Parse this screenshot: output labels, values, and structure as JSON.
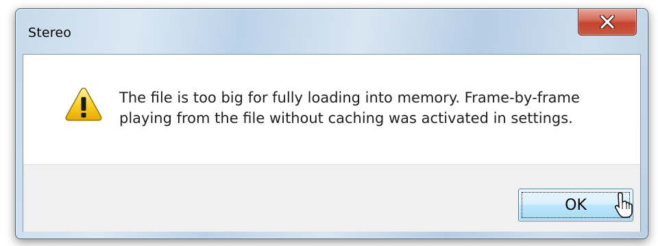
{
  "window": {
    "title": "Stereo",
    "close_icon": "close-x-icon"
  },
  "dialog": {
    "icon": "warning-icon",
    "message_lines": [
      "The file is too big for fully loading into memory. Frame-by-frame",
      "playing from the file without caching was activated in settings."
    ]
  },
  "buttons": {
    "ok_label": "OK"
  },
  "cursor": {
    "icon": "hand-pointer-icon"
  },
  "colors": {
    "close_button": "#c3432e",
    "ok_button_border": "#3c7fb1",
    "warning_fill": "#f5c400",
    "footer_bg": "#f0f0f0"
  }
}
